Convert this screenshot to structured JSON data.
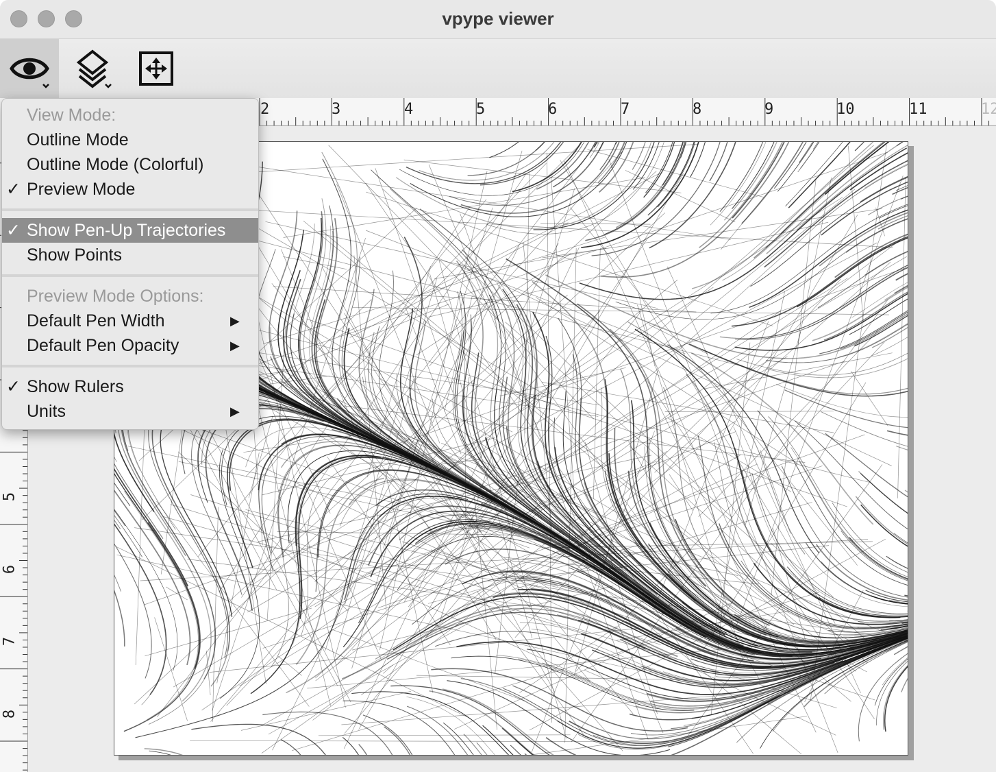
{
  "window": {
    "title": "vpype viewer"
  },
  "toolbar": {
    "view_icon": "eye-icon",
    "layers_icon": "layers-icon",
    "fit_icon": "fit-to-page-icon"
  },
  "rulers": {
    "horizontal_labels": [
      "2",
      "3",
      "4",
      "5",
      "6",
      "7",
      "8",
      "9",
      "10",
      "11",
      "12"
    ],
    "vertical_labels": [
      "5",
      "6",
      "7",
      "8"
    ]
  },
  "menu": {
    "view_mode_header": "View Mode:",
    "outline_mode": "Outline Mode",
    "outline_mode_colorful": "Outline Mode (Colorful)",
    "preview_mode": "Preview Mode",
    "show_pen_up": "Show Pen-Up Trajectories",
    "show_points": "Show Points",
    "preview_options_header": "Preview Mode Options:",
    "default_pen_width": "Default Pen Width",
    "default_pen_opacity": "Default Pen Opacity",
    "show_rulers": "Show Rulers",
    "units": "Units",
    "check_glyph": "✓",
    "submenu_glyph": "▶"
  },
  "colors": {
    "highlight": "#8e8e8e",
    "stroke": "#111111"
  }
}
